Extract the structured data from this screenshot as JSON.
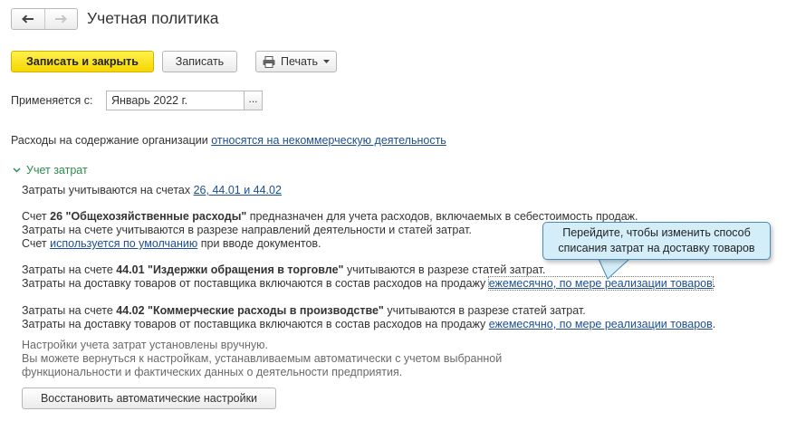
{
  "header": {
    "title": "Учетная политика"
  },
  "toolbar": {
    "save_close_label": "Записать и закрыть",
    "save_label": "Записать",
    "print_label": "Печать"
  },
  "applies": {
    "label": "Применяется с:",
    "value": "Январь 2022 г.",
    "select_button": "..."
  },
  "org_expenses": {
    "text": "Расходы на содержание организации ",
    "link": "относятся на некоммерческую деятельность"
  },
  "cost_section": {
    "title": "Учет затрат",
    "accounts_text": "Затраты учитываются на счетах ",
    "accounts_link": "26, 44.01 и 44.02",
    "acc26": {
      "line1_pre": "Счет ",
      "line1_bold": "26 \"Общехозяйственные расходы\"",
      "line1_post": " предназначен для учета расходов, включаемых в себестоимость продаж.",
      "line2": "Затраты на счете учитываются в разрезе направлений деятельности и статей затрат.",
      "line3_pre": "Счет ",
      "line3_link": "используется по умолчанию",
      "line3_post": " при вводе документов."
    },
    "acc4401": {
      "line1_pre": "Затраты на счете ",
      "line1_bold": "44.01 \"Издержки обращения в торговле\"",
      "line1_post": " учитываются в разрезе статей затрат.",
      "line2_pre": "Затраты на доставку товаров от поставщика включаются в состав расходов на продажу ",
      "line2_link": "ежемесячно, по мере реализации товаров",
      "line2_post": "."
    },
    "acc4402": {
      "line1_pre": "Затраты на счете ",
      "line1_bold": "44.02 \"Коммерческие расходы в производстве\"",
      "line1_post": " учитываются в разрезе статей затрат.",
      "line2_pre": "Затраты на доставку товаров от поставщика включаются в состав расходов на продажу ",
      "line2_link": "ежемесячно, по мере реализации товаров",
      "line2_post": "."
    },
    "note": {
      "line1": "Настройки учета затрат установлены вручную.",
      "line2": "Вы можете вернуться к настройкам, устанавливаемым автоматически с учетом выбранной",
      "line3": "функциональности и фактических данных о деятельности предприятия."
    },
    "restore_button": "Восстановить автоматические настройки"
  },
  "tooltip": {
    "line1": "Перейдите, чтобы изменить способ",
    "line2": "списания затрат на доставку товаров"
  },
  "colors": {
    "primary_button": "#f6d600",
    "link": "#1d4f91",
    "section_header": "#2e8b4e",
    "tooltip_bg": "#d4eef9",
    "tooltip_border": "#4a8bb8"
  },
  "icons": {
    "back": "arrow-left-icon",
    "forward": "arrow-right-icon",
    "print": "printer-icon",
    "dropdown": "caret-down-icon",
    "collapse": "chevron-down-icon"
  }
}
